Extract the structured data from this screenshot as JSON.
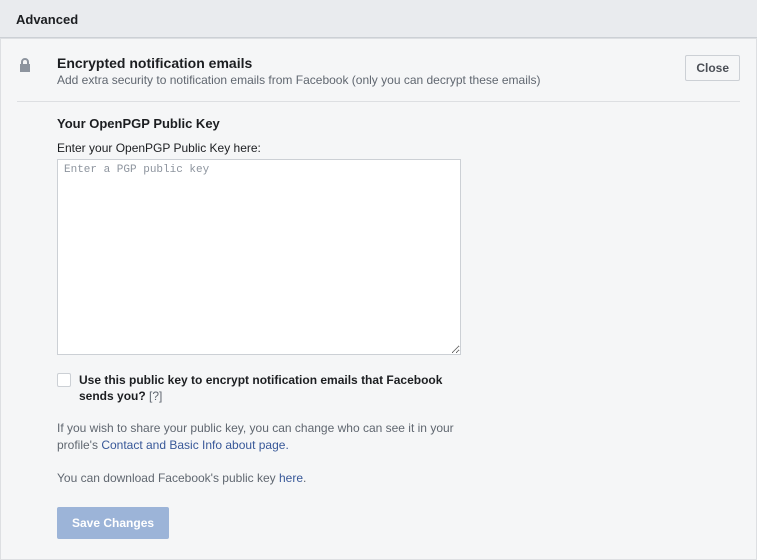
{
  "page": {
    "title": "Advanced"
  },
  "header": {
    "title": "Encrypted notification emails",
    "subtitle": "Add extra security to notification emails from Facebook (only you can decrypt these emails)",
    "close_label": "Close"
  },
  "content": {
    "section_heading": "Your OpenPGP Public Key",
    "field_label": "Enter your OpenPGP Public Key here:",
    "textarea_placeholder": "Enter a PGP public key",
    "textarea_value": "",
    "checkbox_label": "Use this public key to encrypt notification emails that Facebook sends you?",
    "help_mark": "[?]",
    "share_para_prefix": "If you wish to share your public key, you can change who can see it in your profile's ",
    "share_link_text": "Contact and Basic Info about page.",
    "download_para_prefix": "You can download Facebook's public key ",
    "download_link_text": "here",
    "download_para_suffix": ".",
    "save_label": "Save Changes"
  }
}
